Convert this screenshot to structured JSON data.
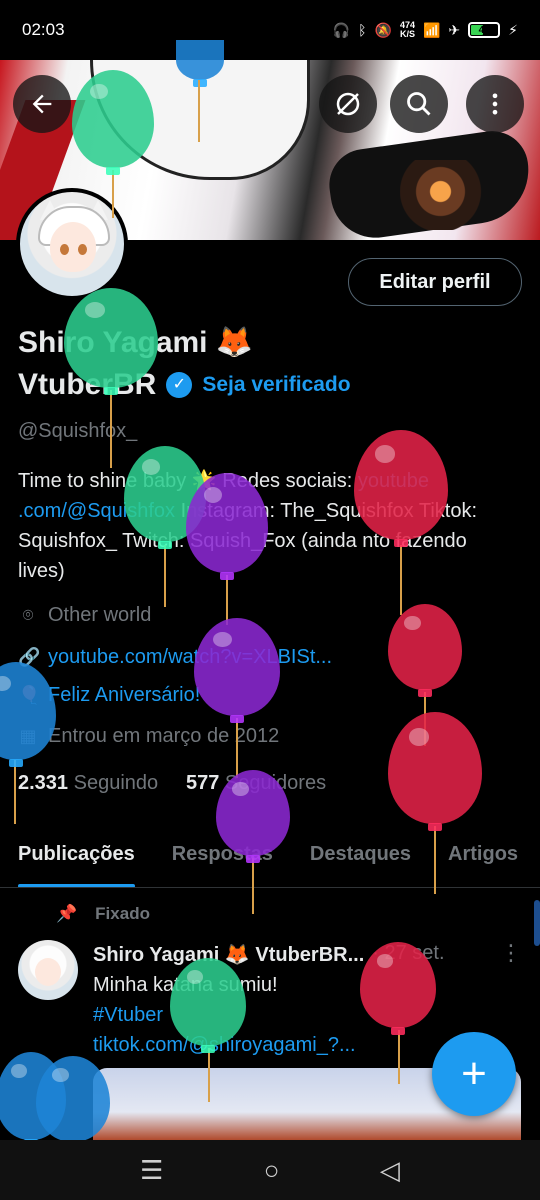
{
  "status_bar": {
    "time": "02:03",
    "speed_top": "474",
    "speed_bottom": "K/S",
    "battery": "43"
  },
  "colors": {
    "accent": "#1d9bf0",
    "background": "#000000",
    "muted": "#71767b",
    "text": "#e7e9ea"
  },
  "header": {
    "back_icon": "arrow-left-icon",
    "icons": [
      "no-signal-circle-icon",
      "search-icon",
      "more-vertical-icon"
    ]
  },
  "profile": {
    "name_line1": "Shiro Yagami 🦊",
    "name_line2": "VtuberBR",
    "get_verified": "Seja verificado",
    "handle": "@Squishfox_",
    "edit_button": "Editar perfil",
    "bio_part1": "Time to shine baby 🌟 Redes sociais: ",
    "bio_link": "youtube .com/@Squishfox",
    "bio_part2": " Instagram: The_Squishfox Tiktok: Squishfox_ Twitch: Squish_Fox (ainda nto fazendo lives)",
    "location": "Other world",
    "website": "youtube.com/watch?v=XLBISt...",
    "birthday": "Feliz Aniversário!",
    "joined": "Entrou em março de 2012",
    "following_count": "2.331",
    "following_label": "Seguindo",
    "followers_count": "577",
    "followers_label": "Seguidores"
  },
  "tabs": [
    {
      "label": "Publicações",
      "active": true
    },
    {
      "label": "Respostas",
      "active": false
    },
    {
      "label": "Destaques",
      "active": false
    },
    {
      "label": "Artigos",
      "active": false
    }
  ],
  "post": {
    "pinned_label": "Fixado",
    "author": "Shiro Yagami 🦊 VtuberBR...",
    "date": "· 27 set.",
    "line1": "Minha katana sumiu!",
    "hashtag": "#Vtuber",
    "link": "tiktok.com/@shiroyagami_?..."
  },
  "fab_label": "+",
  "nav": {
    "menu_icon": "☰",
    "home_icon": "○",
    "back_icon": "◁"
  }
}
